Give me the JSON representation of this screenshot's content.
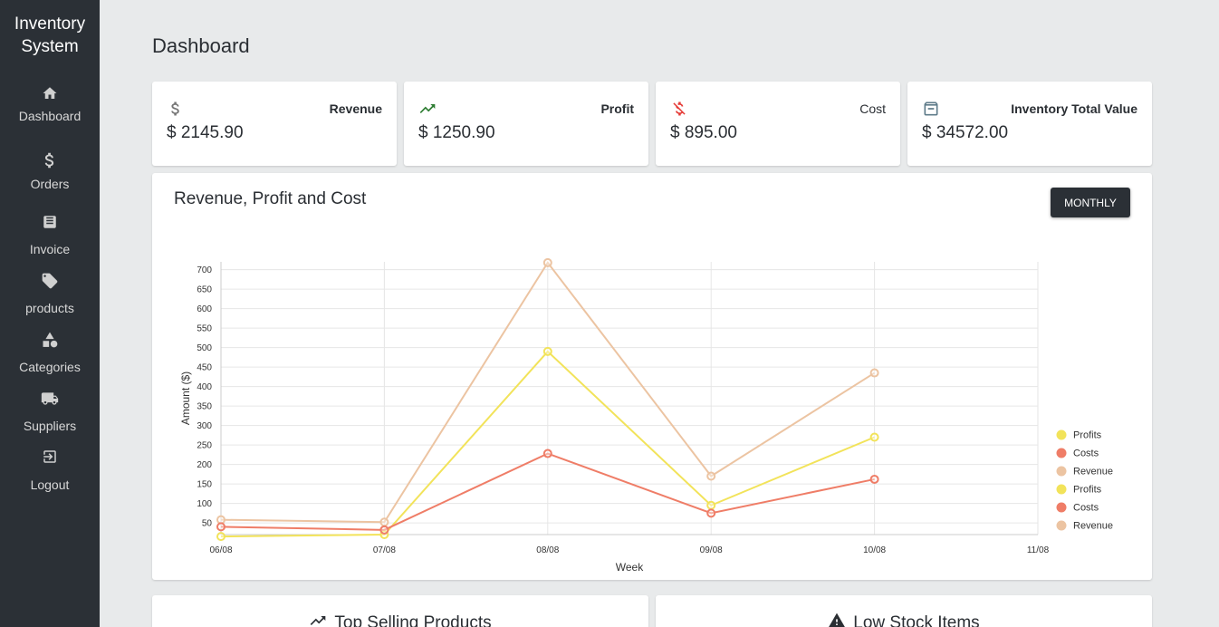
{
  "app": {
    "title_line1": "Inventory",
    "title_line2": "System"
  },
  "sidebar": {
    "items": [
      {
        "label": "Dashboard",
        "icon": "home-icon"
      },
      {
        "label": "Orders",
        "icon": "dollar-icon"
      },
      {
        "label": "Invoice",
        "icon": "receipt-icon"
      },
      {
        "label": "products",
        "icon": "tag-icon"
      },
      {
        "label": "Categories",
        "icon": "shapes-icon"
      },
      {
        "label": "Suppliers",
        "icon": "truck-icon"
      },
      {
        "label": "Logout",
        "icon": "logout-icon"
      }
    ]
  },
  "page": {
    "title": "Dashboard"
  },
  "stats": [
    {
      "label": "Revenue",
      "value": "$ 2145.90",
      "icon": "dollar-icon",
      "color": "#757575"
    },
    {
      "label": "Profit",
      "value": "$ 1250.90",
      "icon": "trending-up-icon",
      "color": "#2e7d32"
    },
    {
      "label": "Cost",
      "value": "$ 895.00",
      "icon": "money-off-icon",
      "color": "#e53935"
    },
    {
      "label": "Inventory Total Value",
      "value": "$ 34572.00",
      "icon": "archive-icon",
      "color": "#607d8b"
    }
  ],
  "chart_section": {
    "title": "Revenue, Profit and Cost",
    "button_label": "MONTHLY"
  },
  "chart_data": {
    "type": "line",
    "xlabel": "Week",
    "ylabel": "Amount ($)",
    "categories": [
      "06/08",
      "07/08",
      "08/08",
      "09/08",
      "10/08",
      "11/08"
    ],
    "yticks": [
      50,
      100,
      150,
      200,
      250,
      300,
      350,
      400,
      450,
      500,
      550,
      600,
      650,
      700
    ],
    "ylim": [
      20,
      720
    ],
    "grid": true,
    "legend_position": "right",
    "series": [
      {
        "name": "Profits",
        "color": "#f2e35a",
        "values": [
          15,
          20,
          490,
          95,
          270,
          null
        ]
      },
      {
        "name": "Costs",
        "color": "#ef7d67",
        "values": [
          40,
          32,
          228,
          75,
          162,
          null
        ]
      },
      {
        "name": "Revenue",
        "color": "#ecc4a2",
        "values": [
          58,
          52,
          718,
          170,
          435,
          null
        ]
      }
    ],
    "legend": [
      {
        "name": "Profits",
        "color": "#f2e35a"
      },
      {
        "name": "Costs",
        "color": "#ef7d67"
      },
      {
        "name": "Revenue",
        "color": "#ecc4a2"
      },
      {
        "name": "Profits",
        "color": "#f2e35a"
      },
      {
        "name": "Costs",
        "color": "#ef7d67"
      },
      {
        "name": "Revenue",
        "color": "#ecc4a2"
      }
    ]
  },
  "bottom": {
    "top_selling_title": "Top Selling Products",
    "low_stock_title": "Low Stock Items"
  }
}
